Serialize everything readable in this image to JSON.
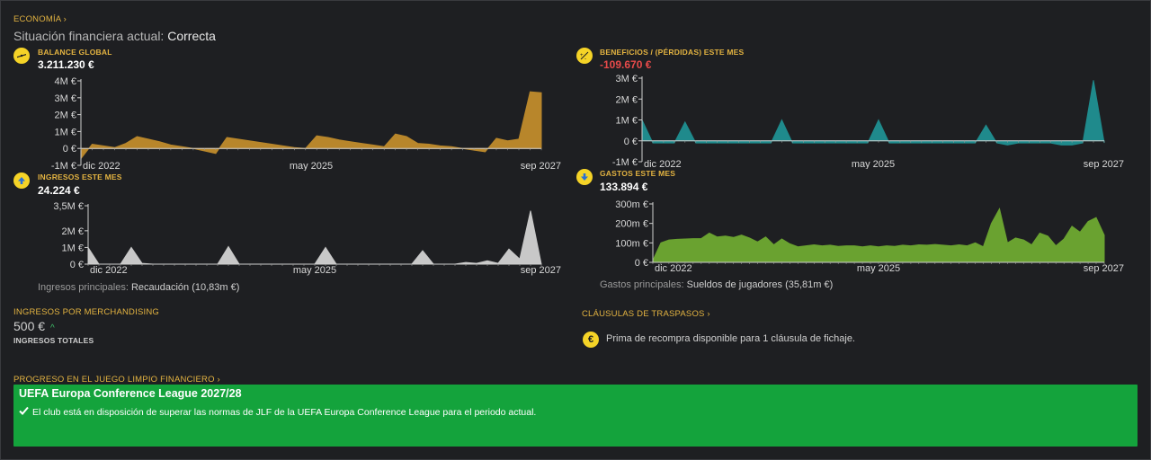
{
  "economy": {
    "section_label": "ECONOMÍA",
    "status_prefix": "Situación financiera actual:",
    "status_value": "Correcta"
  },
  "balance": {
    "label": "BALANCE GLOBAL",
    "value": "3.211.230 €",
    "icon": "scale-icon"
  },
  "profit": {
    "label": "BENEFICIOS / (PÉRDIDAS) ESTE MES",
    "value": "-109.670 €",
    "icon": "percent-icon",
    "value_color": "#e84a4a"
  },
  "income": {
    "label": "INGRESOS ESTE MES",
    "value": "24.224 €",
    "icon": "arrow-up-icon",
    "main_prefix": "Ingresos principales:",
    "main_value": "Recaudación (10,83m €)"
  },
  "expenses": {
    "label": "GASTOS ESTE MES",
    "value": "133.894 €",
    "icon": "arrow-down-icon",
    "main_prefix": "Gastos principales:",
    "main_value": "Sueldos de jugadores (35,81m €)"
  },
  "merch": {
    "label": "INGRESOS POR MERCHANDISING",
    "value": "500 €",
    "trend_symbol": "^",
    "sub_label": "INGRESOS TOTALES"
  },
  "transfer_clauses": {
    "label": "CLÁUSULAS DE TRASPASOS",
    "text": "Prima de recompra disponible para 1 cláusula de fichaje.",
    "icon": "euro-icon"
  },
  "ffp": {
    "label": "PROGRESO EN EL JUEGO LIMPIO FINANCIERO",
    "title": "UEFA Europa Conference League 2027/28",
    "text": "El club está en disposición de superar las normas de JLF de la UEFA Europa Conference League para el periodo actual.",
    "box_color": "#14a33c"
  },
  "chart_data": [
    {
      "id": "balance",
      "type": "area",
      "color": "#b8862b",
      "x_labels": [
        "dic 2022",
        "may 2025",
        "sep 2027"
      ],
      "y_ticks": [
        "4M €",
        "3M €",
        "2M €",
        "1M €",
        "0 €",
        "-1M €"
      ],
      "y_tick_values": [
        4,
        3,
        2,
        1,
        0,
        -1
      ],
      "ylim": [
        -1,
        4
      ],
      "unit": "M €",
      "values": [
        -0.6,
        0.25,
        0.15,
        0.05,
        0.3,
        0.7,
        0.55,
        0.4,
        0.2,
        0.1,
        0.0,
        -0.15,
        -0.3,
        0.65,
        0.55,
        0.45,
        0.35,
        0.25,
        0.15,
        0.05,
        0.0,
        0.75,
        0.65,
        0.5,
        0.4,
        0.3,
        0.2,
        0.1,
        0.85,
        0.7,
        0.3,
        0.25,
        0.15,
        0.1,
        0.0,
        -0.1,
        -0.2,
        0.6,
        0.45,
        0.55,
        3.35,
        3.3
      ]
    },
    {
      "id": "profit",
      "type": "area",
      "color": "#1f8a8c",
      "x_labels": [
        "dic 2022",
        "may 2025",
        "sep 2027"
      ],
      "y_ticks": [
        "3M €",
        "2M €",
        "1M €",
        "0 €",
        "-1M €"
      ],
      "y_tick_values": [
        3,
        2,
        1,
        0,
        -1
      ],
      "ylim": [
        -1,
        3
      ],
      "unit": "M €",
      "values": [
        1.0,
        -0.1,
        -0.1,
        -0.1,
        0.9,
        -0.1,
        -0.1,
        -0.1,
        -0.1,
        -0.1,
        -0.1,
        -0.1,
        -0.1,
        1.0,
        -0.1,
        -0.1,
        -0.1,
        -0.1,
        -0.1,
        -0.1,
        -0.1,
        -0.1,
        1.0,
        -0.1,
        -0.1,
        -0.1,
        -0.1,
        -0.1,
        -0.1,
        -0.1,
        -0.1,
        -0.1,
        0.75,
        -0.1,
        -0.2,
        -0.1,
        -0.1,
        -0.1,
        -0.1,
        -0.2,
        -0.2,
        -0.1,
        2.9,
        -0.1
      ]
    },
    {
      "id": "income",
      "type": "area",
      "color": "#c8c8c8",
      "x_labels": [
        "dic 2022",
        "may 2025",
        "sep 2027"
      ],
      "y_ticks": [
        "3,5M €",
        "2M €",
        "1M €",
        "0 €"
      ],
      "y_tick_values": [
        3.5,
        2,
        1,
        0
      ],
      "ylim": [
        0,
        3.5
      ],
      "unit": "M €",
      "values": [
        1.0,
        0.0,
        0.0,
        0.0,
        1.0,
        0.05,
        0.0,
        0.0,
        0.0,
        0.0,
        0.0,
        0.0,
        0.0,
        1.05,
        0.0,
        0.0,
        0.0,
        0.0,
        0.0,
        0.0,
        0.0,
        0.0,
        1.0,
        0.0,
        0.0,
        0.0,
        0.0,
        0.0,
        0.0,
        0.0,
        0.0,
        0.8,
        0.0,
        0.0,
        0.0,
        0.1,
        0.05,
        0.2,
        0.05,
        0.9,
        0.3,
        3.2,
        0.0
      ]
    },
    {
      "id": "expenses",
      "type": "area",
      "color": "#6aa230",
      "x_labels": [
        "dic 2022",
        "may 2025",
        "sep 2027"
      ],
      "y_ticks": [
        "300m €",
        "200m €",
        "100m €",
        "0 €"
      ],
      "y_tick_values": [
        300,
        200,
        100,
        0
      ],
      "ylim": [
        0,
        300
      ],
      "unit": "m €",
      "values": [
        10,
        100,
        115,
        118,
        120,
        122,
        122,
        150,
        130,
        135,
        128,
        140,
        125,
        105,
        130,
        90,
        120,
        95,
        80,
        85,
        90,
        85,
        88,
        82,
        85,
        85,
        80,
        85,
        80,
        85,
        82,
        88,
        85,
        90,
        88,
        92,
        88,
        85,
        90,
        85,
        100,
        80,
        200,
        275,
        100,
        125,
        115,
        90,
        150,
        135,
        85,
        120,
        185,
        155,
        210,
        230,
        140
      ]
    }
  ]
}
